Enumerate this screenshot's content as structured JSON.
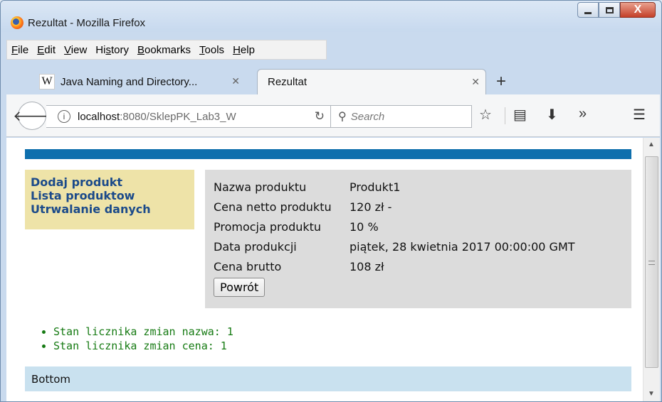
{
  "window": {
    "title": "Rezultat - Mozilla Firefox",
    "close_glyph": "X"
  },
  "menu": [
    {
      "key": "F",
      "rest": "ile"
    },
    {
      "key": "E",
      "rest": "dit"
    },
    {
      "key": "V",
      "rest": "iew"
    },
    {
      "pre": "Hi",
      "key": "s",
      "rest": "tory"
    },
    {
      "key": "B",
      "rest": "ookmarks"
    },
    {
      "key": "T",
      "rest": "ools"
    },
    {
      "key": "H",
      "rest": "elp"
    }
  ],
  "tabs": [
    {
      "label": "Java Naming and Directory...",
      "favicon": "W",
      "active": false
    },
    {
      "label": "Rezultat",
      "active": true
    }
  ],
  "urlbar": {
    "host": "localhost",
    "rest": ":8080/SklepPK_Lab3_W"
  },
  "search": {
    "placeholder": "Search"
  },
  "page": {
    "menu_links": [
      "Dodaj produkt",
      "Lista produktow",
      "Utrwalanie danych"
    ],
    "details": [
      {
        "label": "Nazwa produktu",
        "value": "Produkt1"
      },
      {
        "label": "Cena netto produktu",
        "value": "120 zł -"
      },
      {
        "label": "Promocja produktu",
        "value": "10 %"
      },
      {
        "label": "Data produkcji",
        "value": "piątek, 28 kwietnia 2017 00:00:00 GMT"
      },
      {
        "label": "Cena brutto",
        "value": "108 zł"
      }
    ],
    "back_button": "Powrót",
    "counters": [
      "Stan licznika zmian nazwa: 1",
      "Stan licznika zmian cena: 1"
    ],
    "footer": "Bottom"
  },
  "colors": {
    "header_bar": "#0e6fad",
    "menu_bg": "#eee3a8",
    "details_bg": "#dcdcdc",
    "counter_text": "#157a12",
    "footer_bg": "#c9e1ef"
  }
}
